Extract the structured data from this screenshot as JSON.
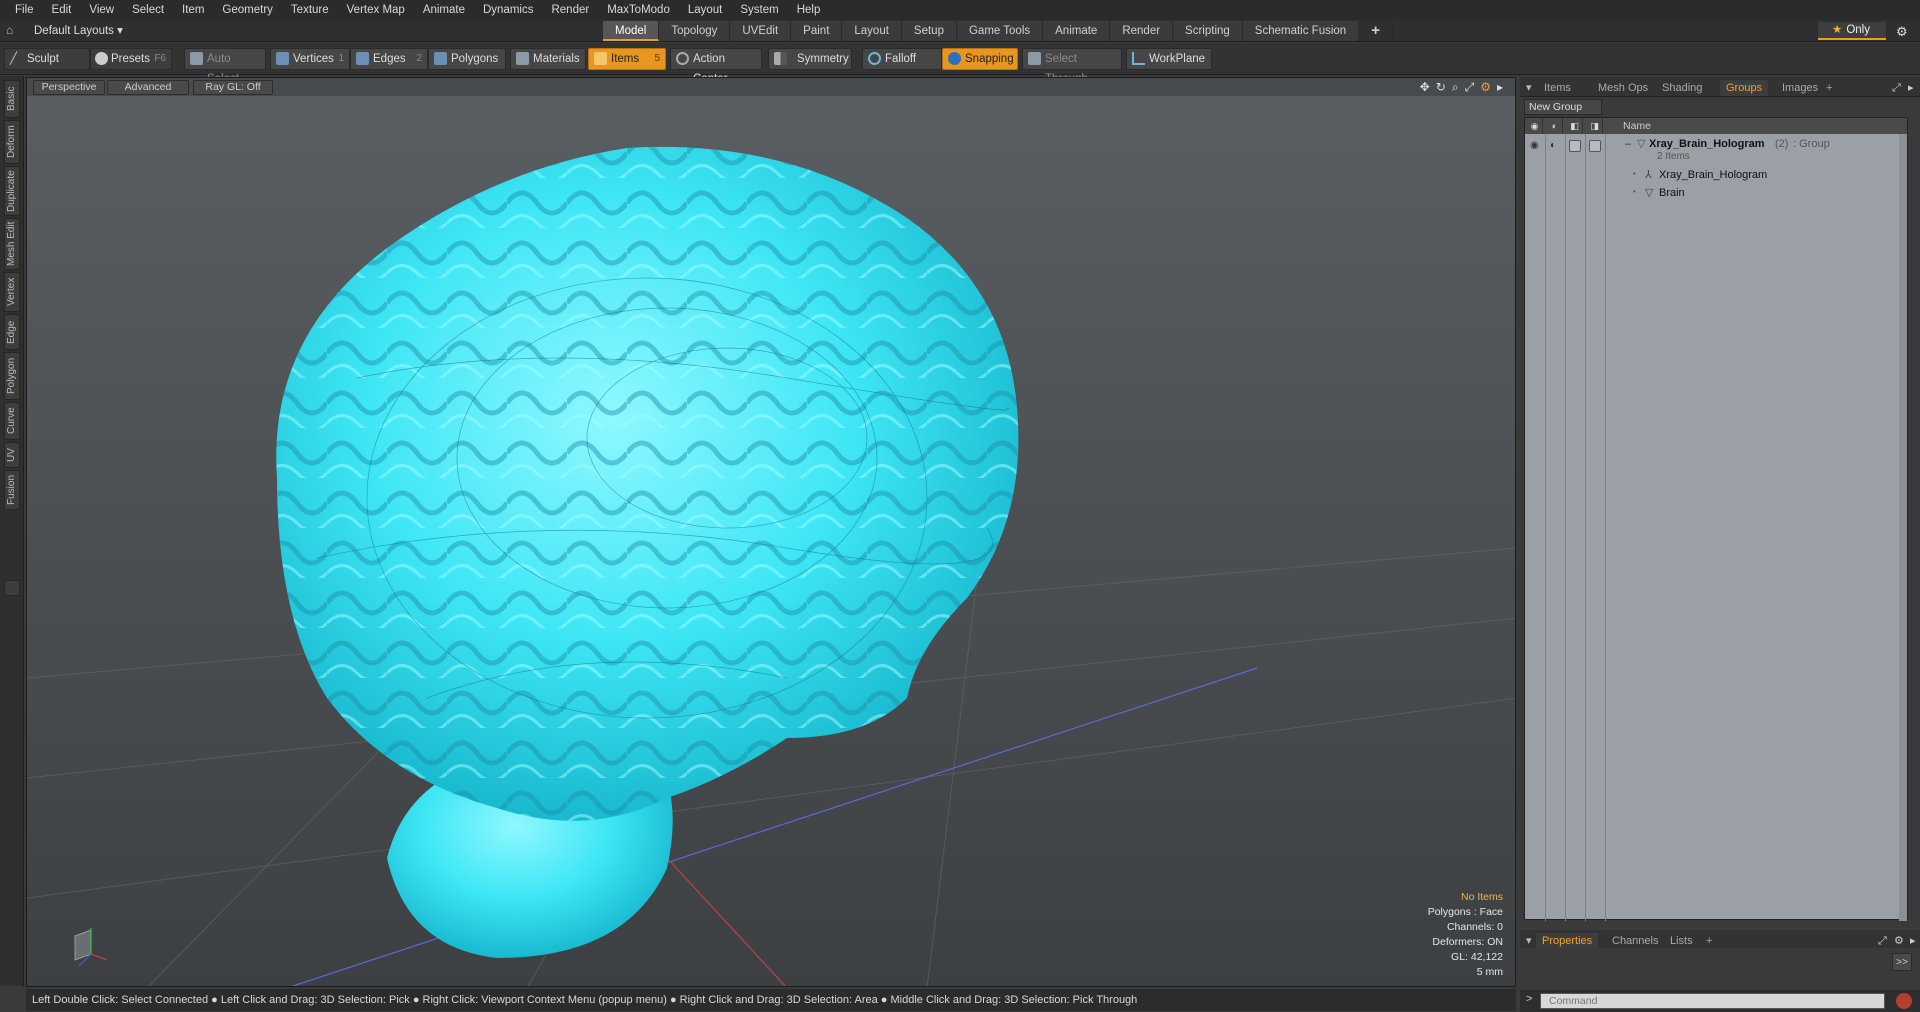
{
  "menubar": [
    "File",
    "Edit",
    "View",
    "Select",
    "Item",
    "Geometry",
    "Texture",
    "Vertex Map",
    "Animate",
    "Dynamics",
    "Render",
    "MaxToModo",
    "Layout",
    "System",
    "Help"
  ],
  "layoutbar": {
    "layouts_label": "Default Layouts ▾",
    "tabs": [
      "Model",
      "Topology",
      "UVEdit",
      "Paint",
      "Layout",
      "Setup",
      "Game Tools",
      "Animate",
      "Render",
      "Scripting",
      "Schematic Fusion"
    ],
    "active_tab": "Model",
    "only_label": "Only"
  },
  "toolbar": {
    "sculpt": "Sculpt",
    "presets": "Presets",
    "presets_key": "F6",
    "auto_select": "Auto Select",
    "vertices": "Vertices",
    "vertices_key": "1",
    "edges": "Edges",
    "edges_key": "2",
    "polygons": "Polygons",
    "materials": "Materials",
    "items": "Items",
    "items_key": "5",
    "action_center": "Action Center",
    "symmetry": "Symmetry",
    "falloff": "Falloff",
    "snapping": "Snapping",
    "select_through": "Select Through",
    "workplane": "WorkPlane"
  },
  "lefttabs": [
    "Basic",
    "Deform",
    "Duplicate",
    "Mesh Edit",
    "Vertex",
    "Edge",
    "Polygon",
    "Curve",
    "UV",
    "Fusion"
  ],
  "viewport": {
    "view_mode": "Perspective",
    "shading": "Advanced",
    "raygl": "Ray GL: Off",
    "info": {
      "no_items": "No Items",
      "polygons": "Polygons : Face",
      "channels": "Channels: 0",
      "deformers": "Deformers: ON",
      "gl": "GL: 42,122",
      "scale": "5 mm"
    },
    "model_color": "#3ee6f5"
  },
  "statusbar": "Left Double Click: Select Connected ● Left Click and Drag: 3D Selection: Pick ● Right Click: Viewport Context Menu (popup menu) ● Right Click and Drag: 3D Selection: Area ● Middle Click and Drag: 3D Selection: Pick Through",
  "rightpanel": {
    "tabs": [
      "Items",
      "Mesh Ops",
      "Shading",
      "Groups",
      "Images"
    ],
    "active_tab": "Groups",
    "new_group": "New Group",
    "col_name": "Name",
    "group": {
      "name": "Xray_Brain_Hologram",
      "count": "(2)",
      "type": ": Group",
      "items_label": "2 Items",
      "children": [
        "Xray_Brain_Hologram",
        "Brain"
      ]
    },
    "bottom_tabs": [
      "Properties",
      "Channels",
      "Lists"
    ],
    "command_placeholder": "Command",
    "expand_label": ">>"
  }
}
